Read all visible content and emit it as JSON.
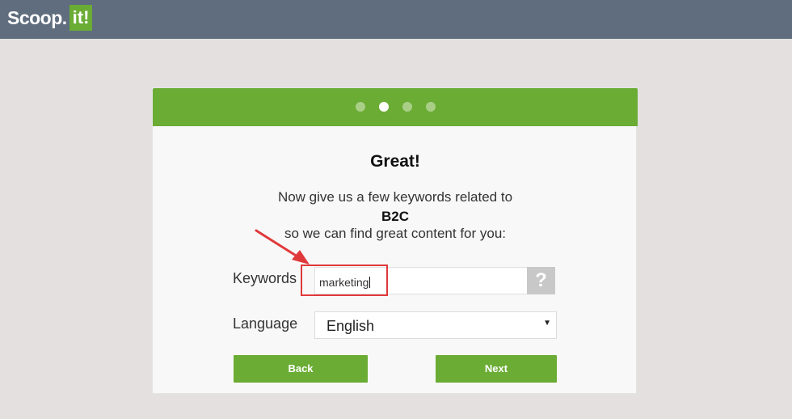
{
  "header": {
    "logo_scoop": "Scoop.",
    "logo_it": "it!"
  },
  "wizard": {
    "steps": 4,
    "active_step": 2,
    "title": "Great!",
    "message_line1": "Now give us a few keywords related to",
    "topic": "B2C",
    "message_line3": "so we can find great content for you:",
    "keywords_label": "Keywords",
    "keywords_value": "marketing",
    "help_label": "?",
    "language_label": "Language",
    "language_selected": "English",
    "back_label": "Back",
    "next_label": "Next"
  },
  "colors": {
    "topbar": "#5f6d7e",
    "brand_green": "#6aac34",
    "annotation_red": "#e0393b"
  },
  "icons": {
    "dropdown": "triangle-down",
    "help": "question-mark"
  }
}
